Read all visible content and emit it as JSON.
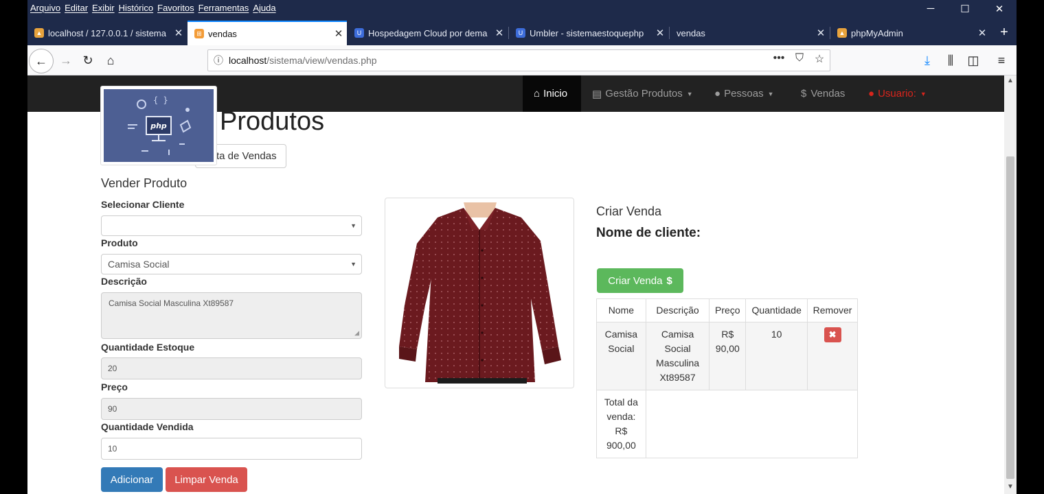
{
  "browser": {
    "menu": [
      "Arquivo",
      "Editar",
      "Exibir",
      "Histórico",
      "Favoritos",
      "Ferramentas",
      "Ajuda"
    ],
    "tabs": [
      {
        "label": "localhost / 127.0.0.1 / sistema",
        "active": false
      },
      {
        "label": "vendas",
        "active": true
      },
      {
        "label": "Hospedagem Cloud por dema",
        "active": false
      },
      {
        "label": "Umbler - sistemaestoquephp",
        "active": false
      },
      {
        "label": "vendas",
        "active": false
      },
      {
        "label": "phpMyAdmin",
        "active": false
      }
    ],
    "url_host": "localhost",
    "url_path": "/sistema/view/vendas.php"
  },
  "site_nav": {
    "home": "Inicio",
    "products": "Gestão Produtos",
    "people": "Pessoas",
    "sales": "Vendas",
    "user": "Usuario:"
  },
  "page": {
    "title": "Produtos",
    "list_button": "ta de Vendas",
    "logo_text": "php"
  },
  "form": {
    "heading": "Vender Produto",
    "client_label": "Selecionar Cliente",
    "client_value": "",
    "product_label": "Produto",
    "product_value": "Camisa Social",
    "description_label": "Descrição",
    "description_value": "Camisa Social Masculina Xt89587",
    "stock_label": "Quantidade Estoque",
    "stock_value": "20",
    "price_label": "Preço",
    "price_value": "90",
    "qty_label": "Quantidade Vendida",
    "qty_value": "10",
    "add_button": "Adicionar",
    "clear_button": "Limpar Venda"
  },
  "sale": {
    "heading": "Criar Venda",
    "client_label": "Nome de cliente:",
    "create_button": "Criar Venda",
    "create_icon": "$",
    "columns": [
      "Nome",
      "Descrição",
      "Preço",
      "Quantidade",
      "Remover"
    ],
    "item": {
      "name": "Camisa Social",
      "description": "Camisa Social Masculina Xt89587",
      "price": "R$ 90,00",
      "quantity": "10",
      "remove": "✖"
    },
    "total": "Total da venda: R$ 900,00"
  },
  "colors": {
    "browser_chrome": "#1e2a4a",
    "site_nav": "#222222",
    "primary": "#337ab7",
    "danger": "#d9534f",
    "success": "#5cb85c"
  }
}
